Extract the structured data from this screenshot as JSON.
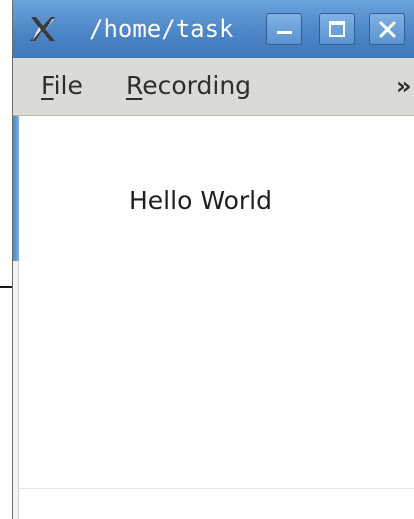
{
  "window": {
    "title": "/home/task",
    "title_visible": "/home/tas",
    "app_icon": "x-app-icon",
    "controls": {
      "minimize_icon": "minimize-icon",
      "maximize_icon": "maximize-icon",
      "close_icon": "close-icon"
    }
  },
  "menubar": {
    "items": [
      {
        "mnemonic": "F",
        "rest": "ile",
        "label": "File"
      },
      {
        "mnemonic": "R",
        "rest": "ecording",
        "label": "Recording"
      }
    ],
    "overflow": "»"
  },
  "content": {
    "text": "Hello World"
  },
  "colors": {
    "titlebar": "#4d86c6",
    "menubar": "#dcdad5",
    "background": "#ffffff"
  }
}
